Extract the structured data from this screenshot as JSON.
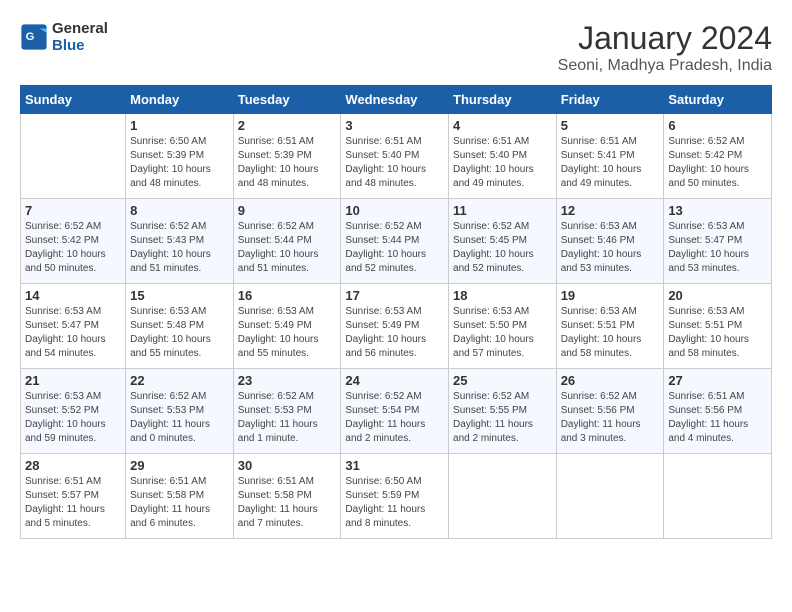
{
  "header": {
    "logo_line1": "General",
    "logo_line2": "Blue",
    "month_title": "January 2024",
    "location": "Seoni, Madhya Pradesh, India"
  },
  "weekdays": [
    "Sunday",
    "Monday",
    "Tuesday",
    "Wednesday",
    "Thursday",
    "Friday",
    "Saturday"
  ],
  "weeks": [
    [
      {
        "day": "",
        "info": ""
      },
      {
        "day": "1",
        "info": "Sunrise: 6:50 AM\nSunset: 5:39 PM\nDaylight: 10 hours\nand 48 minutes."
      },
      {
        "day": "2",
        "info": "Sunrise: 6:51 AM\nSunset: 5:39 PM\nDaylight: 10 hours\nand 48 minutes."
      },
      {
        "day": "3",
        "info": "Sunrise: 6:51 AM\nSunset: 5:40 PM\nDaylight: 10 hours\nand 48 minutes."
      },
      {
        "day": "4",
        "info": "Sunrise: 6:51 AM\nSunset: 5:40 PM\nDaylight: 10 hours\nand 49 minutes."
      },
      {
        "day": "5",
        "info": "Sunrise: 6:51 AM\nSunset: 5:41 PM\nDaylight: 10 hours\nand 49 minutes."
      },
      {
        "day": "6",
        "info": "Sunrise: 6:52 AM\nSunset: 5:42 PM\nDaylight: 10 hours\nand 50 minutes."
      }
    ],
    [
      {
        "day": "7",
        "info": "Sunrise: 6:52 AM\nSunset: 5:42 PM\nDaylight: 10 hours\nand 50 minutes."
      },
      {
        "day": "8",
        "info": "Sunrise: 6:52 AM\nSunset: 5:43 PM\nDaylight: 10 hours\nand 51 minutes."
      },
      {
        "day": "9",
        "info": "Sunrise: 6:52 AM\nSunset: 5:44 PM\nDaylight: 10 hours\nand 51 minutes."
      },
      {
        "day": "10",
        "info": "Sunrise: 6:52 AM\nSunset: 5:44 PM\nDaylight: 10 hours\nand 52 minutes."
      },
      {
        "day": "11",
        "info": "Sunrise: 6:52 AM\nSunset: 5:45 PM\nDaylight: 10 hours\nand 52 minutes."
      },
      {
        "day": "12",
        "info": "Sunrise: 6:53 AM\nSunset: 5:46 PM\nDaylight: 10 hours\nand 53 minutes."
      },
      {
        "day": "13",
        "info": "Sunrise: 6:53 AM\nSunset: 5:47 PM\nDaylight: 10 hours\nand 53 minutes."
      }
    ],
    [
      {
        "day": "14",
        "info": "Sunrise: 6:53 AM\nSunset: 5:47 PM\nDaylight: 10 hours\nand 54 minutes."
      },
      {
        "day": "15",
        "info": "Sunrise: 6:53 AM\nSunset: 5:48 PM\nDaylight: 10 hours\nand 55 minutes."
      },
      {
        "day": "16",
        "info": "Sunrise: 6:53 AM\nSunset: 5:49 PM\nDaylight: 10 hours\nand 55 minutes."
      },
      {
        "day": "17",
        "info": "Sunrise: 6:53 AM\nSunset: 5:49 PM\nDaylight: 10 hours\nand 56 minutes."
      },
      {
        "day": "18",
        "info": "Sunrise: 6:53 AM\nSunset: 5:50 PM\nDaylight: 10 hours\nand 57 minutes."
      },
      {
        "day": "19",
        "info": "Sunrise: 6:53 AM\nSunset: 5:51 PM\nDaylight: 10 hours\nand 58 minutes."
      },
      {
        "day": "20",
        "info": "Sunrise: 6:53 AM\nSunset: 5:51 PM\nDaylight: 10 hours\nand 58 minutes."
      }
    ],
    [
      {
        "day": "21",
        "info": "Sunrise: 6:53 AM\nSunset: 5:52 PM\nDaylight: 10 hours\nand 59 minutes."
      },
      {
        "day": "22",
        "info": "Sunrise: 6:52 AM\nSunset: 5:53 PM\nDaylight: 11 hours\nand 0 minutes."
      },
      {
        "day": "23",
        "info": "Sunrise: 6:52 AM\nSunset: 5:53 PM\nDaylight: 11 hours\nand 1 minute."
      },
      {
        "day": "24",
        "info": "Sunrise: 6:52 AM\nSunset: 5:54 PM\nDaylight: 11 hours\nand 2 minutes."
      },
      {
        "day": "25",
        "info": "Sunrise: 6:52 AM\nSunset: 5:55 PM\nDaylight: 11 hours\nand 2 minutes."
      },
      {
        "day": "26",
        "info": "Sunrise: 6:52 AM\nSunset: 5:56 PM\nDaylight: 11 hours\nand 3 minutes."
      },
      {
        "day": "27",
        "info": "Sunrise: 6:51 AM\nSunset: 5:56 PM\nDaylight: 11 hours\nand 4 minutes."
      }
    ],
    [
      {
        "day": "28",
        "info": "Sunrise: 6:51 AM\nSunset: 5:57 PM\nDaylight: 11 hours\nand 5 minutes."
      },
      {
        "day": "29",
        "info": "Sunrise: 6:51 AM\nSunset: 5:58 PM\nDaylight: 11 hours\nand 6 minutes."
      },
      {
        "day": "30",
        "info": "Sunrise: 6:51 AM\nSunset: 5:58 PM\nDaylight: 11 hours\nand 7 minutes."
      },
      {
        "day": "31",
        "info": "Sunrise: 6:50 AM\nSunset: 5:59 PM\nDaylight: 11 hours\nand 8 minutes."
      },
      {
        "day": "",
        "info": ""
      },
      {
        "day": "",
        "info": ""
      },
      {
        "day": "",
        "info": ""
      }
    ]
  ]
}
